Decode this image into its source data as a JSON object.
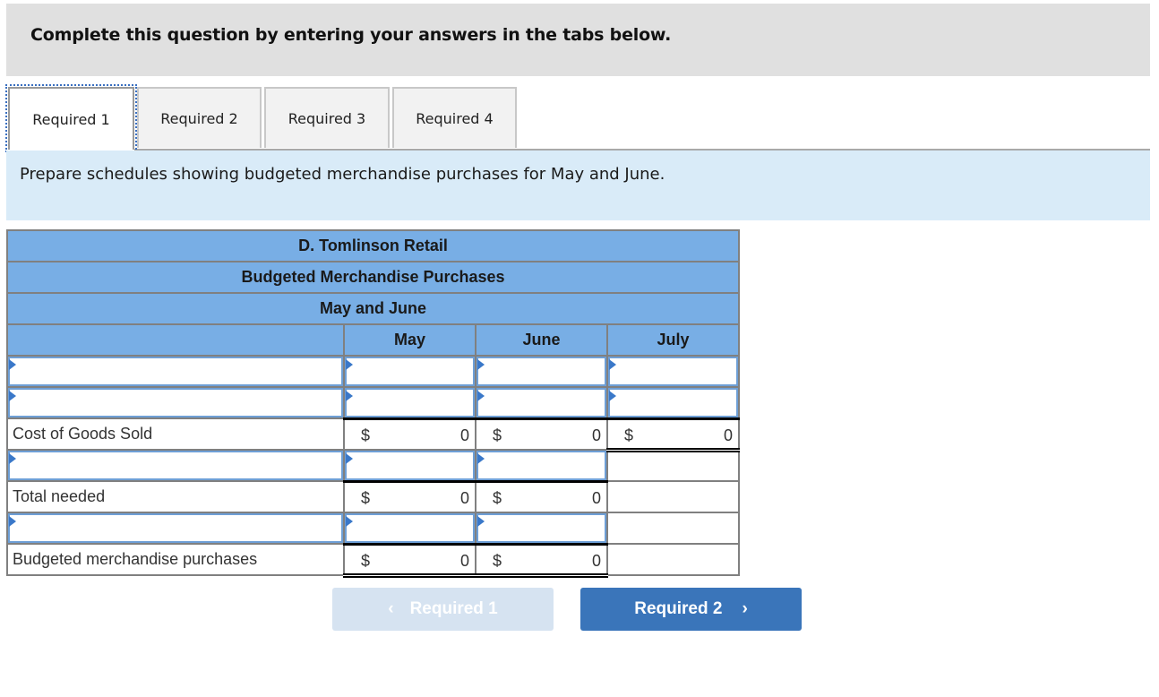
{
  "banner": {
    "text": "Complete this question by entering your answers in the tabs below."
  },
  "tabs": [
    {
      "label": "Required 1",
      "active": true
    },
    {
      "label": "Required 2",
      "active": false
    },
    {
      "label": "Required 3",
      "active": false
    },
    {
      "label": "Required 4",
      "active": false
    }
  ],
  "instruction": "Prepare schedules showing budgeted merchandise purchases for May and June.",
  "schedule": {
    "company": "D. Tomlinson Retail",
    "title": "Budgeted Merchandise Purchases",
    "period": "May and June",
    "columns": [
      "May",
      "June",
      "July"
    ],
    "rows": [
      {
        "label": "",
        "input": true,
        "values": [
          "",
          "",
          ""
        ]
      },
      {
        "label": "",
        "input": true,
        "values": [
          "",
          "",
          ""
        ]
      },
      {
        "label": "Cost of Goods Sold",
        "input": false,
        "currency": "$",
        "values": [
          "0",
          "0",
          "0"
        ]
      },
      {
        "label": "",
        "input": true,
        "values": [
          "",
          ""
        ]
      },
      {
        "label": "Total needed",
        "input": false,
        "currency": "$",
        "values": [
          "0",
          "0"
        ]
      },
      {
        "label": "",
        "input": true,
        "values": [
          "",
          ""
        ]
      },
      {
        "label": "Budgeted merchandise purchases",
        "input": false,
        "currency": "$",
        "values": [
          "0",
          "0"
        ]
      }
    ]
  },
  "nav": {
    "prev_label": "Required 1",
    "next_label": "Required 2",
    "prev_icon": "‹",
    "next_icon": "›"
  },
  "colors": {
    "header_blue": "#78aee5",
    "button_blue": "#3a75ba",
    "button_disabled": "#d6e3f1",
    "instruction_bg": "#d9ebf8"
  }
}
